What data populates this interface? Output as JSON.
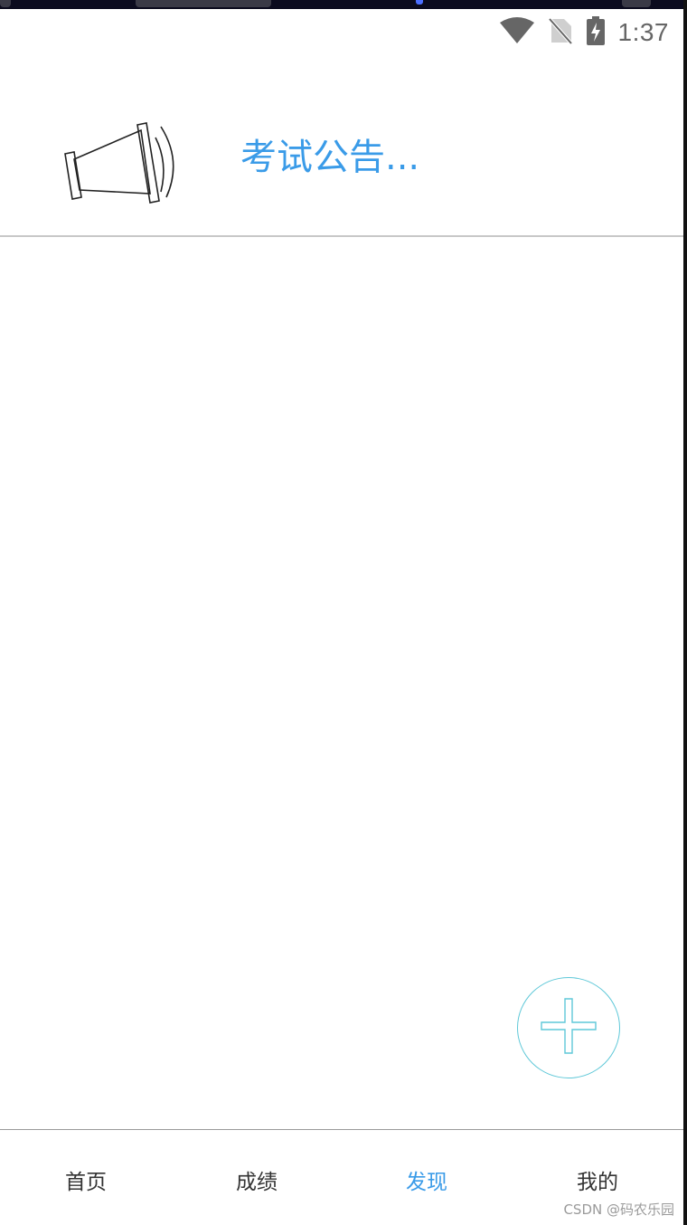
{
  "status_bar": {
    "time": "1:37",
    "icons": [
      "wifi-icon",
      "no-sim-icon",
      "battery-charging-icon"
    ]
  },
  "announcement": {
    "icon": "megaphone-icon",
    "title": "考试公告..."
  },
  "fab": {
    "icon": "plus-icon",
    "color": "#5fc8d8"
  },
  "bottom_nav": {
    "items": [
      {
        "label": "首页",
        "active": false
      },
      {
        "label": "成绩",
        "active": false
      },
      {
        "label": "发现",
        "active": true
      },
      {
        "label": "我的",
        "active": false
      }
    ]
  },
  "watermark": "CSDN @码农乐园",
  "colors": {
    "accent": "#3a9be8",
    "divider": "#c8c8c8",
    "nav_text": "#333333"
  }
}
